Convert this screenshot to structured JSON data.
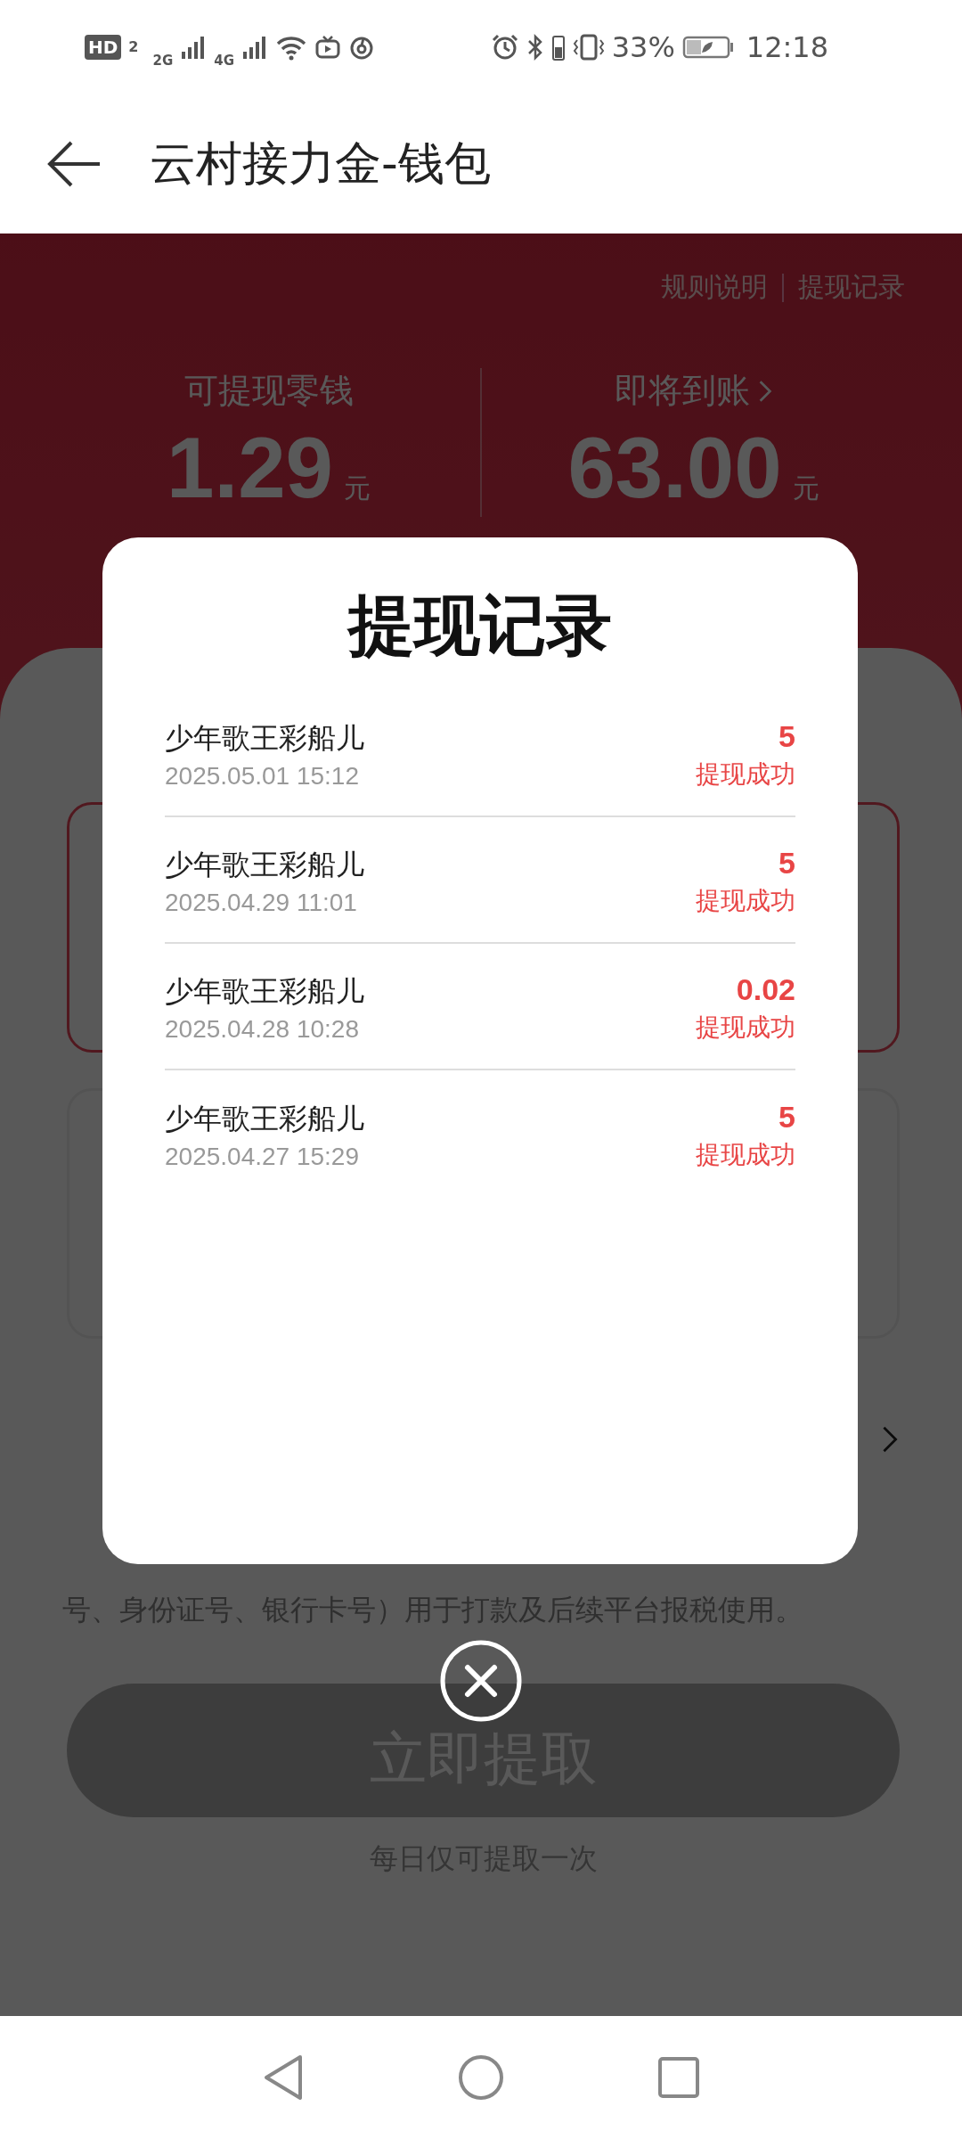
{
  "status_bar": {
    "hd": "HD",
    "sim": "2",
    "networks": [
      "2G",
      "4G"
    ],
    "battery": "33%",
    "time": "12:18"
  },
  "header": {
    "title": "云村接力金-钱包"
  },
  "banner": {
    "links": [
      "规则说明",
      "提现记录"
    ],
    "balances": [
      {
        "label": "可提现零钱",
        "amount": "1.29",
        "unit": "元",
        "has_arrow": false
      },
      {
        "label": "即将到账",
        "amount": "63.00",
        "unit": "元",
        "has_arrow": true
      }
    ]
  },
  "page": {
    "tax_note": "号、身份证号、银行卡号）用于打款及后续平台报税使用。",
    "withdraw_button": {
      "label": "立即提取",
      "disabled": true
    },
    "daily_limit": "每日仅可提取一次"
  },
  "dialog": {
    "title": "提现记录",
    "records": [
      {
        "name": "少年歌王彩船儿",
        "time": "2025.05.01 15:12",
        "amount": "5",
        "status": "提现成功"
      },
      {
        "name": "少年歌王彩船儿",
        "time": "2025.04.29 11:01",
        "amount": "5",
        "status": "提现成功"
      },
      {
        "name": "少年歌王彩船儿",
        "time": "2025.04.28 10:28",
        "amount": "0.02",
        "status": "提现成功"
      },
      {
        "name": "少年歌王彩船儿",
        "time": "2025.04.27 15:29",
        "amount": "5",
        "status": "提现成功"
      }
    ]
  }
}
